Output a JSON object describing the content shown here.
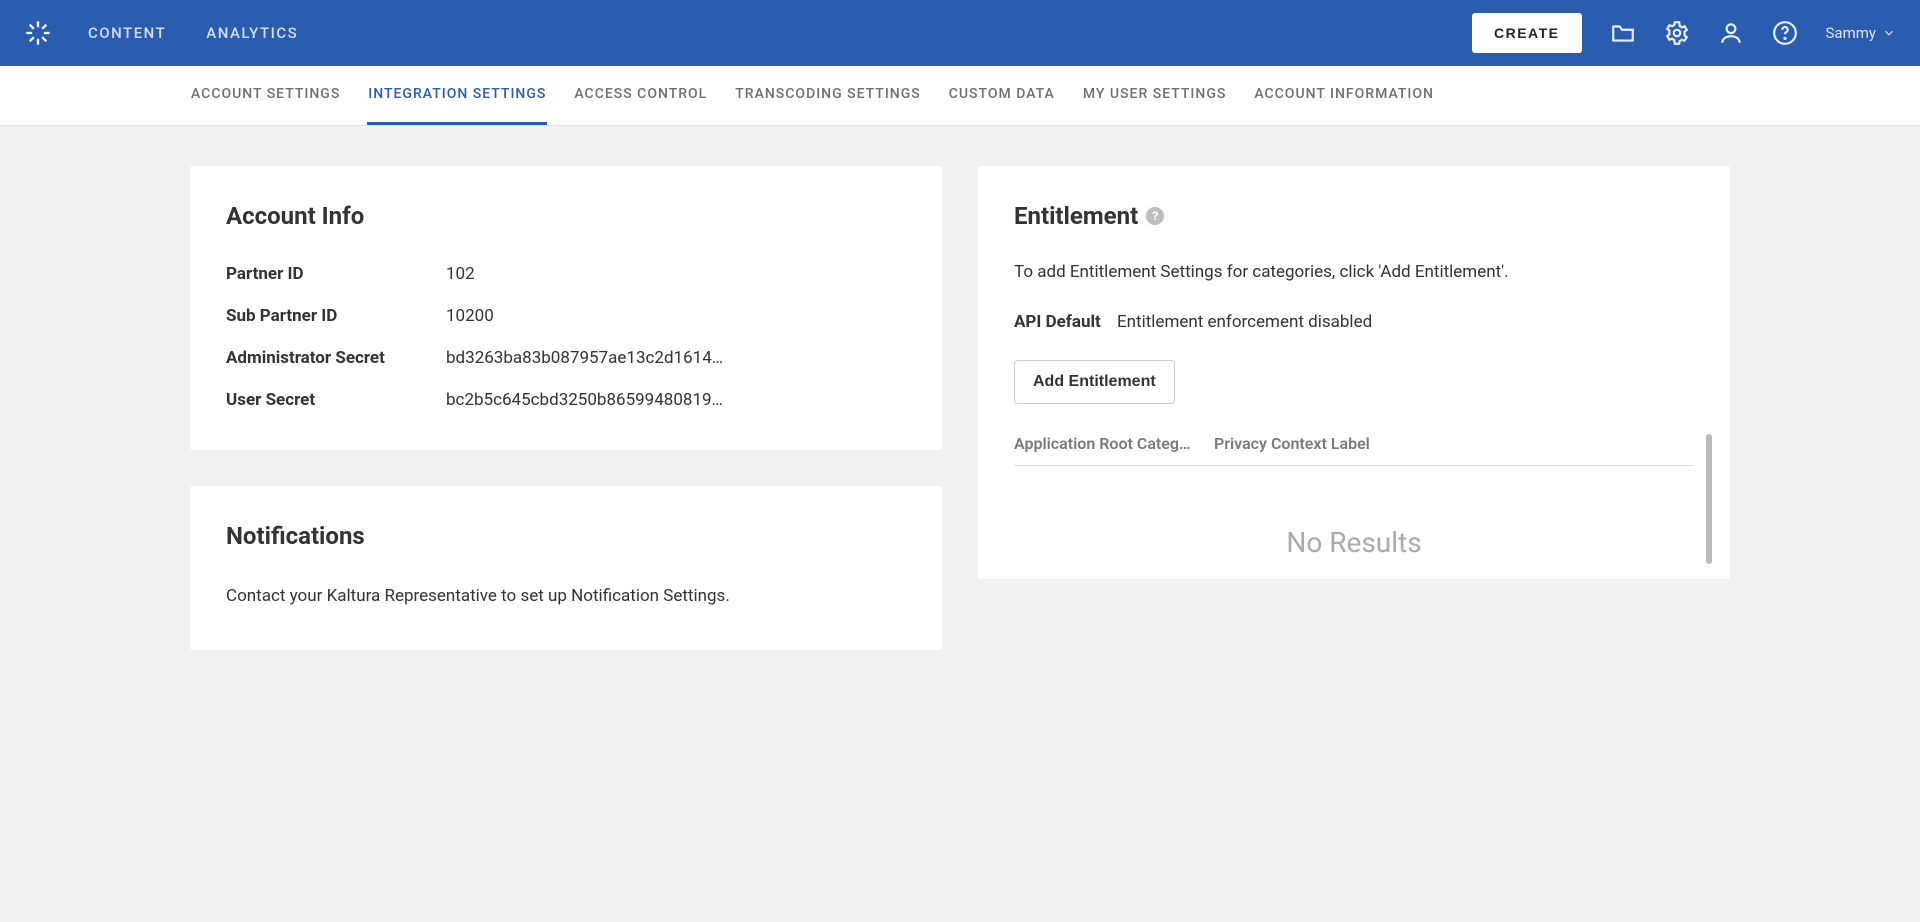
{
  "header": {
    "nav": {
      "content": "CONTENT",
      "analytics": "ANALYTICS"
    },
    "create_label": "CREATE",
    "username": "Sammy"
  },
  "tabs": {
    "account_settings": "ACCOUNT SETTINGS",
    "integration_settings": "INTEGRATION SETTINGS",
    "access_control": "ACCESS CONTROL",
    "transcoding_settings": "TRANSCODING SETTINGS",
    "custom_data": "CUSTOM DATA",
    "my_user_settings": "MY USER SETTINGS",
    "account_information": "ACCOUNT INFORMATION"
  },
  "account_info": {
    "title": "Account Info",
    "rows": {
      "partner_id": {
        "label": "Partner ID",
        "value": "102"
      },
      "sub_partner_id": {
        "label": "Sub Partner ID",
        "value": "10200"
      },
      "admin_secret": {
        "label": "Administrator Secret",
        "value": "bd3263ba83b087957ae13c2d1614…"
      },
      "user_secret": {
        "label": "User Secret",
        "value": "bc2b5c645cbd3250b86599480819…"
      }
    }
  },
  "notifications": {
    "title": "Notifications",
    "body": "Contact your Kaltura Representative to set up Notification Settings."
  },
  "entitlement": {
    "title": "Entitlement",
    "help_glyph": "?",
    "intro": "To add Entitlement Settings for categories, click 'Add Entitlement'.",
    "api_default_label": "API Default",
    "api_default_value": "Entitlement enforcement disabled",
    "add_button": "Add Entitlement",
    "columns": {
      "root": "Application Root Categ…",
      "privacy": "Privacy Context Label"
    },
    "no_results": "No Results"
  }
}
